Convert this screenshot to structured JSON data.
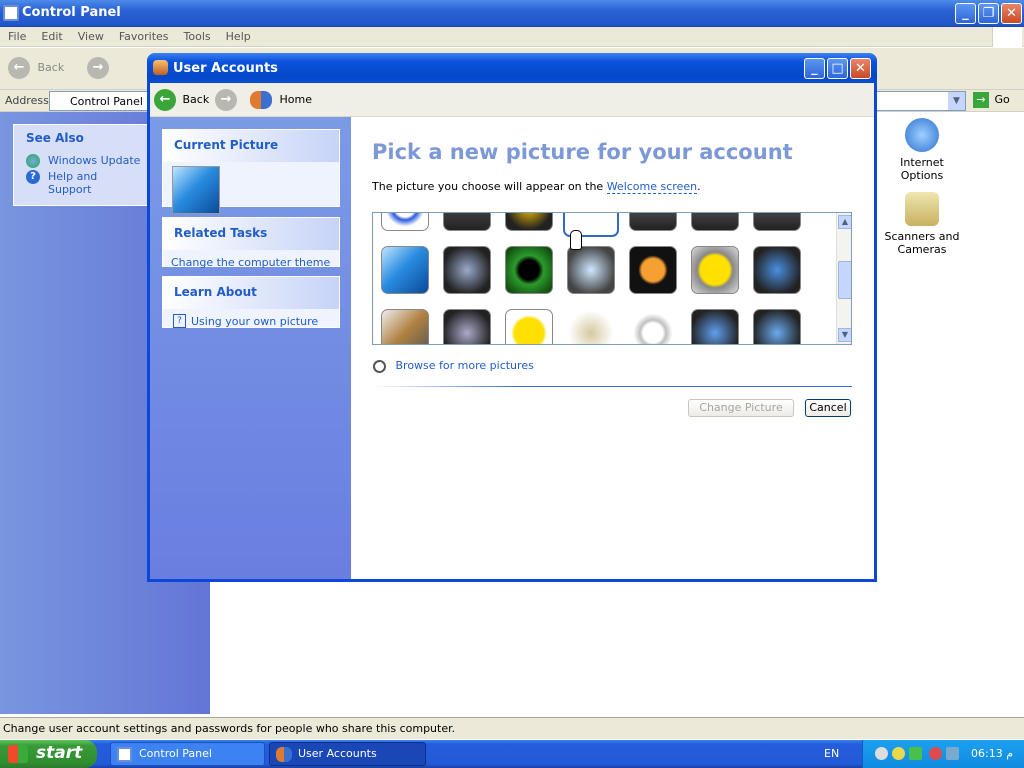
{
  "control_panel": {
    "title": "Control Panel",
    "menu": [
      "File",
      "Edit",
      "View",
      "Favorites",
      "Tools",
      "Help"
    ],
    "toolbar_back": "Back",
    "address_label": "Address",
    "address_value": "Control Panel",
    "go_label": "Go",
    "see_also": {
      "title": "See Also",
      "items": [
        "Windows Update",
        "Help and Support"
      ]
    },
    "icons": [
      {
        "label": "Internet Options"
      },
      {
        "label": "Scanners and Cameras"
      }
    ],
    "status": "Change user account settings and passwords for people who share this computer."
  },
  "user_accounts": {
    "title": "User Accounts",
    "nav": {
      "back": "Back",
      "home": "Home"
    },
    "current_picture": {
      "title": "Current Picture"
    },
    "related_tasks": {
      "title": "Related Tasks",
      "items": [
        "Change the computer theme"
      ]
    },
    "learn_about": {
      "title": "Learn About",
      "items": [
        "Using your own picture"
      ]
    },
    "heading": "Pick a new picture for your account",
    "description_prefix": "The picture you choose will appear on the ",
    "description_link": "Welcome screen",
    "description_suffix": ".",
    "browse": "Browse for more pictures",
    "change_button": "Change Picture",
    "cancel_button": "Cancel"
  },
  "taskbar": {
    "start": "start",
    "tasks": [
      "Control Panel",
      "User Accounts"
    ],
    "language": "EN",
    "time": "06:13 م"
  }
}
